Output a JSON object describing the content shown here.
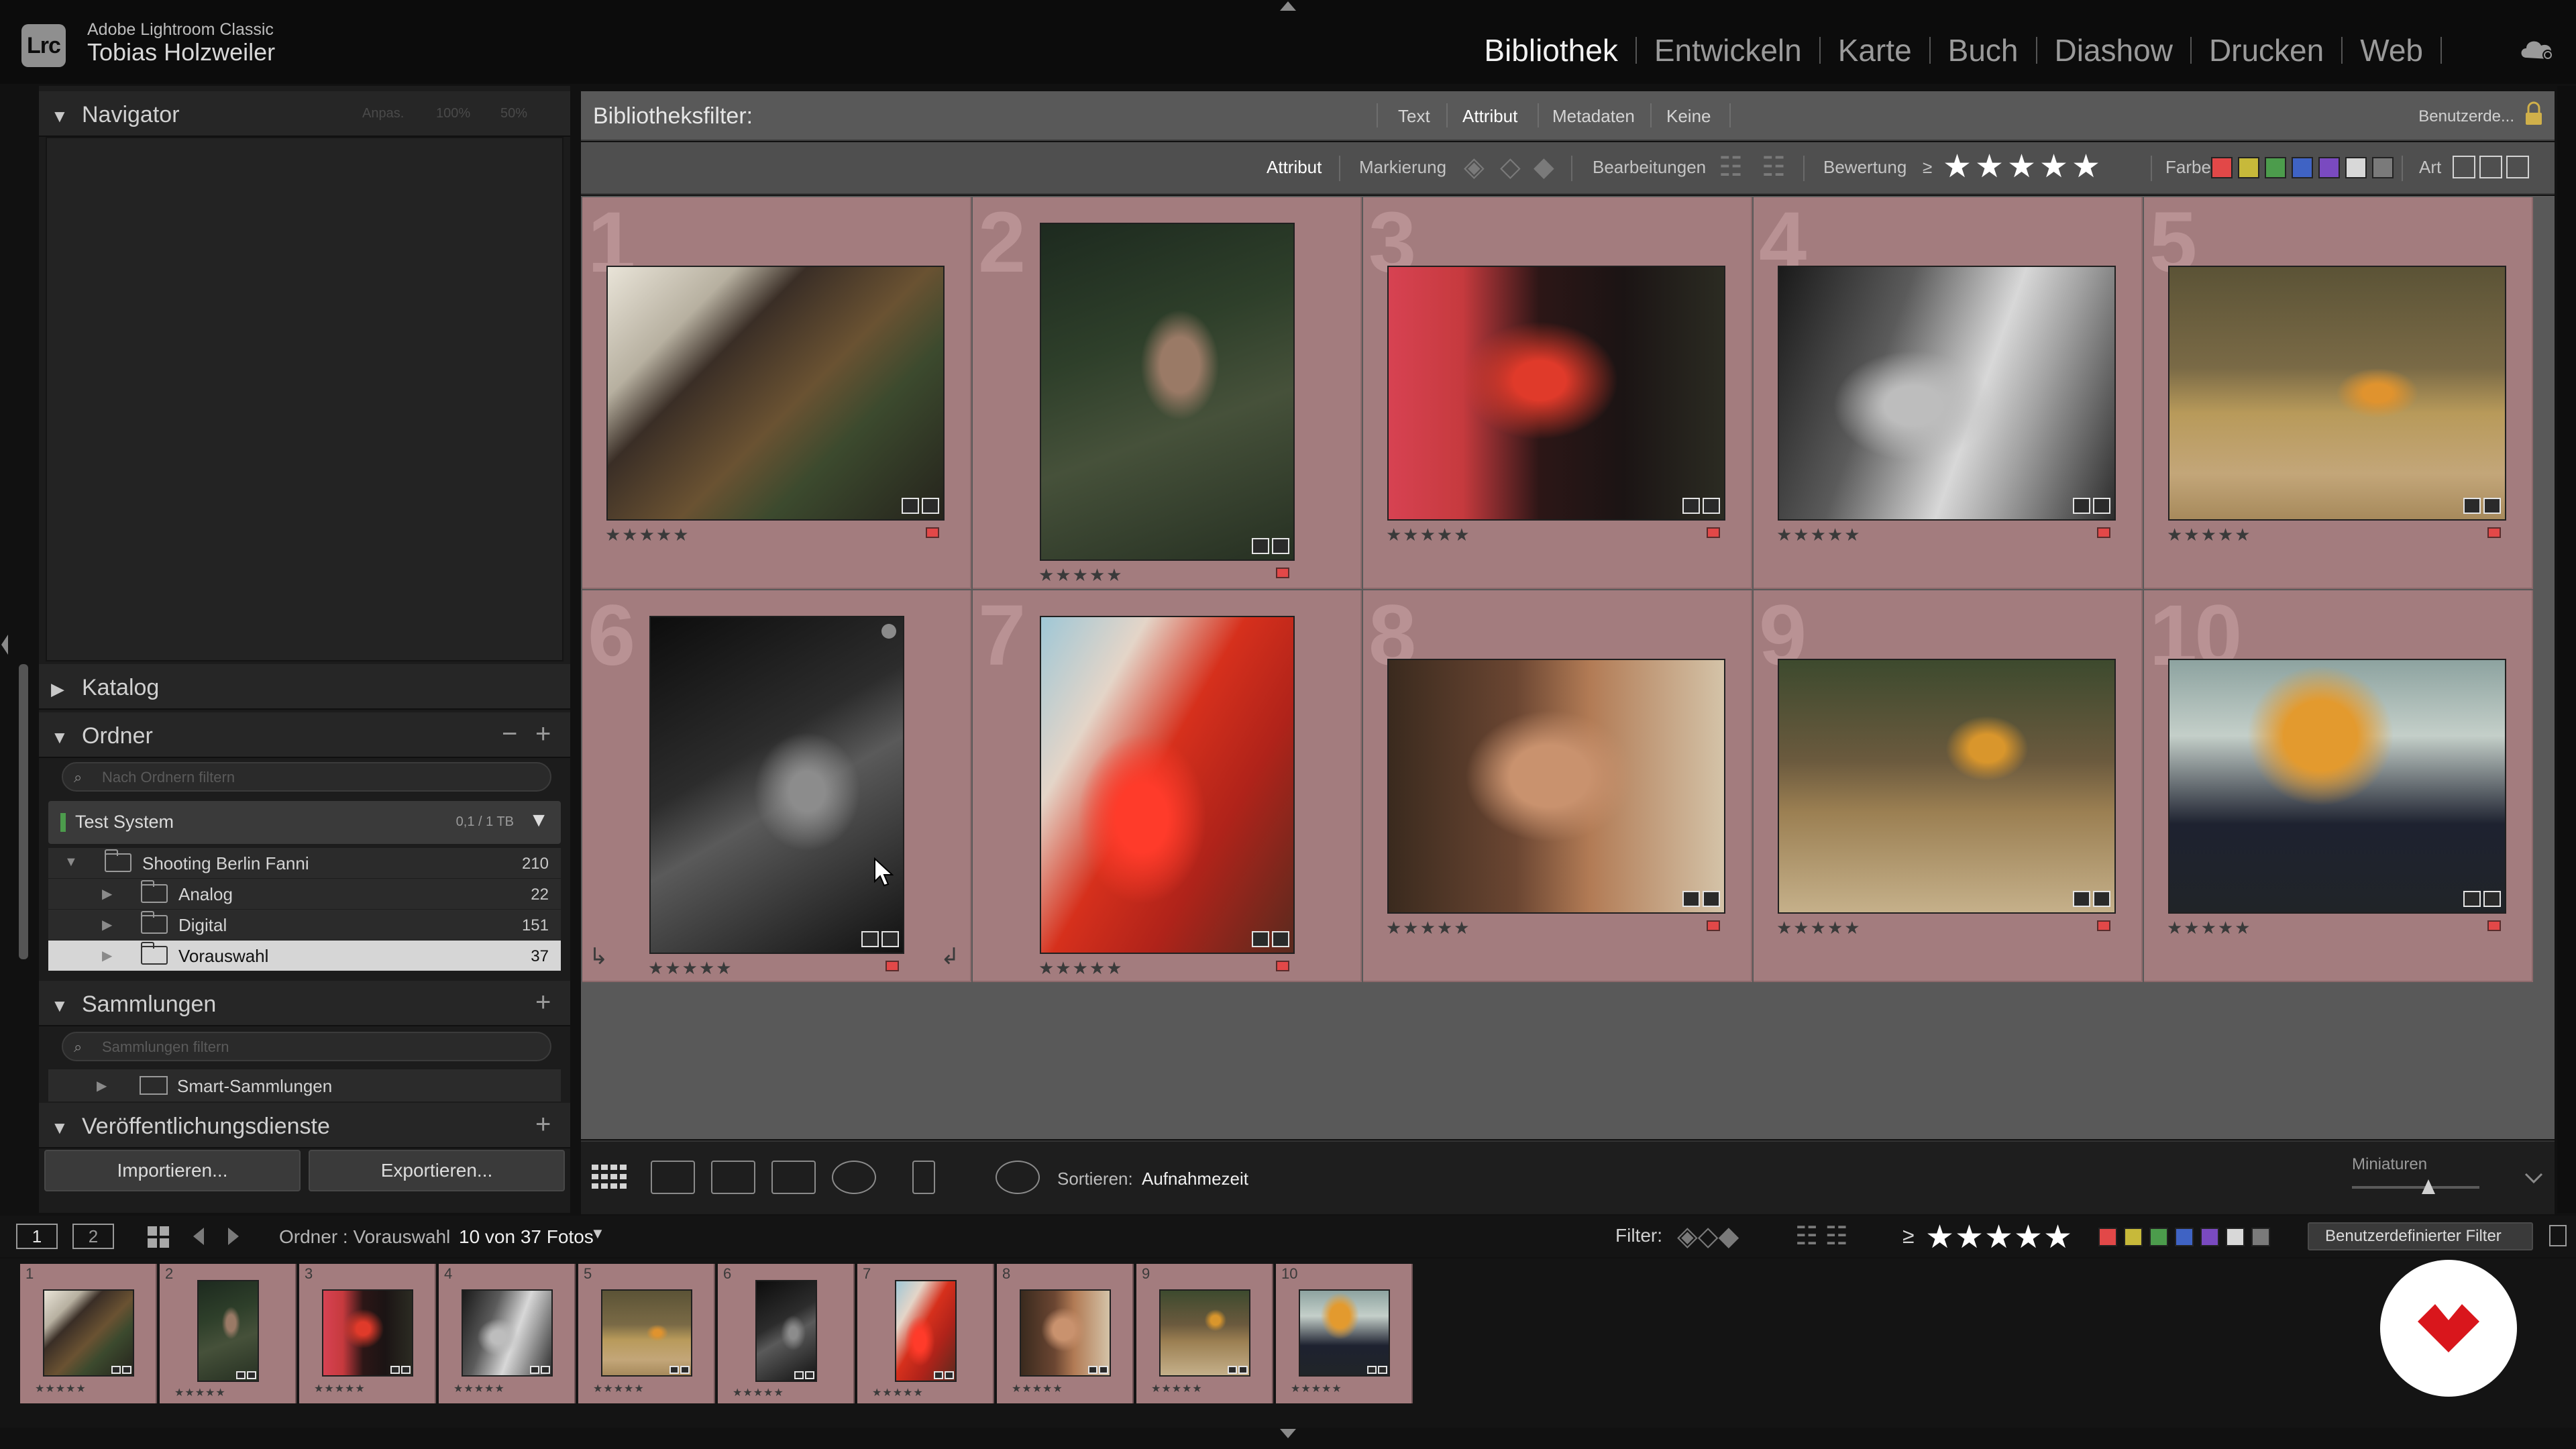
{
  "app": {
    "name": "Adobe Lightroom Classic",
    "badge": "Lrc",
    "user": "Tobias Holzweiler",
    "modules": [
      {
        "label": "Bibliothek",
        "active": true
      },
      {
        "label": "Entwickeln",
        "active": false
      },
      {
        "label": "Karte",
        "active": false
      },
      {
        "label": "Buch",
        "active": false
      },
      {
        "label": "Diashow",
        "active": false
      },
      {
        "label": "Drucken",
        "active": false
      },
      {
        "label": "Web",
        "active": false
      }
    ]
  },
  "left_panel": {
    "navigator": {
      "title": "Navigator",
      "zoom_options": [
        "Anpas.",
        "100%",
        "50%"
      ]
    },
    "catalog": {
      "title": "Katalog"
    },
    "folders": {
      "title": "Ordner",
      "filter_placeholder": "Nach Ordnern filtern",
      "volume": {
        "name": "Test System",
        "size": "0,1 / 1 TB"
      },
      "items": [
        {
          "name": "Shooting Berlin Fanni",
          "count": "210",
          "level": 0,
          "expanded": true,
          "selected": false
        },
        {
          "name": "Analog",
          "count": "22",
          "level": 1,
          "expanded": false,
          "selected": false
        },
        {
          "name": "Digital",
          "count": "151",
          "level": 1,
          "expanded": false,
          "selected": false
        },
        {
          "name": "Vorauswahl",
          "count": "37",
          "level": 1,
          "expanded": false,
          "selected": true
        }
      ]
    },
    "collections": {
      "title": "Sammlungen",
      "filter_placeholder": "Sammlungen filtern",
      "items": [
        {
          "name": "Smart-Sammlungen"
        }
      ]
    },
    "publish": {
      "title": "Veröffentlichungsdienste"
    },
    "buttons": {
      "import": "Importieren...",
      "export": "Exportieren..."
    }
  },
  "library_filter": {
    "label": "Bibliotheksfilter:",
    "tabs": [
      {
        "label": "Text",
        "active": false
      },
      {
        "label": "Attribut",
        "active": true
      },
      {
        "label": "Metadaten",
        "active": false
      },
      {
        "label": "Keine",
        "active": false
      }
    ],
    "preset": "Benutzerde...",
    "attribute_bar": {
      "attribute_label": "Attribut",
      "flag_label": "Markierung",
      "edits_label": "Bearbeitungen",
      "rating_label": "Bewertung",
      "rating_operator": "≥",
      "rating_value": 5,
      "rating_glyph": "★",
      "color_label": "Farbe",
      "colors": [
        "#e24848",
        "#c7b93a",
        "#4c9c4c",
        "#3f63c4",
        "#7a4ac0",
        "#d8d8d8",
        "#7a7a7a"
      ],
      "kind_label": "Art"
    }
  },
  "grid": {
    "cells": [
      {
        "index": "1",
        "stars": "★★★★★",
        "color_label": "#e24848",
        "photo_class": "p1",
        "orientation": "landscape"
      },
      {
        "index": "2",
        "stars": "★★★★★",
        "color_label": "#e24848",
        "photo_class": "p2",
        "orientation": "portrait"
      },
      {
        "index": "3",
        "stars": "★★★★★",
        "color_label": "#e24848",
        "photo_class": "p3",
        "orientation": "landscape"
      },
      {
        "index": "4",
        "stars": "★★★★★",
        "color_label": "#e24848",
        "photo_class": "p4",
        "orientation": "landscape"
      },
      {
        "index": "5",
        "stars": "★★★★★",
        "color_label": "#e24848",
        "photo_class": "p5",
        "orientation": "landscape"
      },
      {
        "index": "6",
        "stars": "★★★★★",
        "color_label": "#e24848",
        "photo_class": "p6",
        "orientation": "portrait"
      },
      {
        "index": "7",
        "stars": "★★★★★",
        "color_label": "#e24848",
        "photo_class": "p7",
        "orientation": "portrait"
      },
      {
        "index": "8",
        "stars": "★★★★★",
        "color_label": "#e24848",
        "photo_class": "p8",
        "orientation": "landscape"
      },
      {
        "index": "9",
        "stars": "★★★★★",
        "color_label": "#e24848",
        "photo_class": "p9",
        "orientation": "landscape"
      },
      {
        "index": "10",
        "stars": "★★★★★",
        "color_label": "#e24848",
        "photo_class": "p10",
        "orientation": "landscape"
      }
    ]
  },
  "toolbar": {
    "sort_label": "Sortieren:",
    "sort_value": "Aufnahmezeit",
    "thumbnails_label": "Miniaturen",
    "thumbnail_size": 0.6
  },
  "filmstrip": {
    "tabs": [
      "1",
      "2"
    ],
    "path": "Ordner : Vorauswahl",
    "count": "10 von 37 Fotos",
    "filter_label": "Filter:",
    "rating_operator": "≥",
    "custom_filter": "Benutzerdefinierter Filter"
  },
  "colors": {
    "cell_bg": "#a37c7e",
    "grid_bg": "#595959",
    "panel_bg": "#1c1c1c",
    "brand": "#d9161c"
  },
  "icons": [
    "lightroom-badge-icon",
    "cloud-sync-icon",
    "lock-icon",
    "grid-view-icon",
    "loupe-view-icon",
    "compare-view-icon",
    "survey-view-icon",
    "people-view-icon",
    "spray-can-icon",
    "sort-direction-icon",
    "rotate-left-icon",
    "rotate-right-icon",
    "mouse-cursor-icon",
    "brand-logo-icon"
  ]
}
